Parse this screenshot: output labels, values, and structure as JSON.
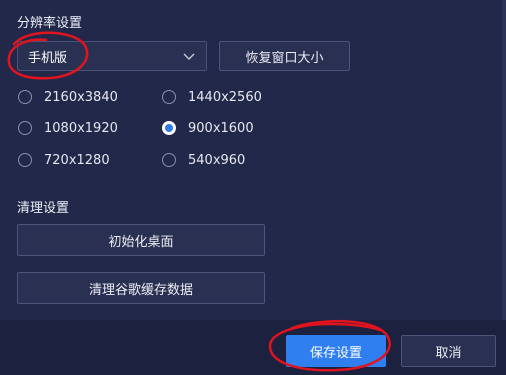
{
  "resolution_section": {
    "title": "分辨率设置",
    "mode_select": {
      "value": "手机版"
    },
    "restore_button": "恢复窗口大小",
    "options": [
      {
        "label": "2160x3840",
        "checked": false
      },
      {
        "label": "1440x2560",
        "checked": false
      },
      {
        "label": "1080x1920",
        "checked": false
      },
      {
        "label": "900x1600",
        "checked": true
      },
      {
        "label": "720x1280",
        "checked": false
      },
      {
        "label": "540x960",
        "checked": false
      }
    ]
  },
  "cleanup_section": {
    "title": "清理设置",
    "reset_desktop_button": "初始化桌面",
    "clear_chrome_cache_button": "清理谷歌缓存数据"
  },
  "footer": {
    "save_button": "保存设置",
    "cancel_button": "取消"
  },
  "colors": {
    "background": "#222849",
    "accent": "#2f7ff0",
    "annotation": "#e0141e"
  }
}
